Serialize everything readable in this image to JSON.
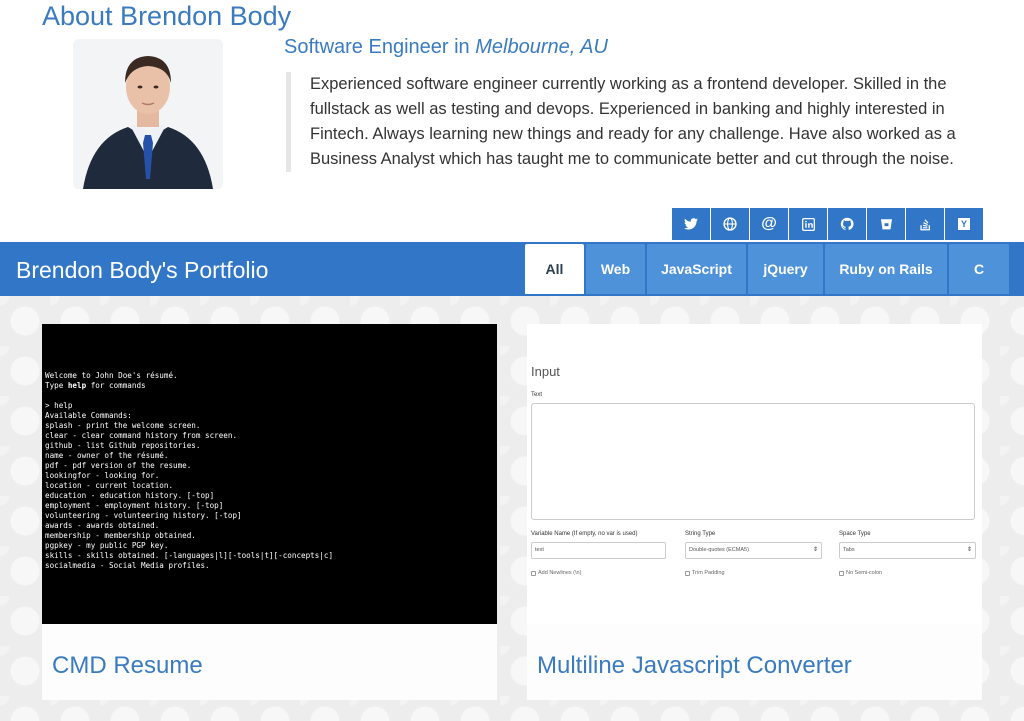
{
  "about": {
    "title": "About Brendon Body",
    "subtitle_prefix": "Software Engineer in ",
    "location": "Melbourne, AU",
    "bio": "Experienced software engineer currently working as a frontend developer. Skilled in the fullstack as well as testing and devops. Experienced in banking and highly interested in Fintech. Always learning new things and ready for any challenge. Have also worked as a Business Analyst which has taught me to communicate better and cut through the noise."
  },
  "social": [
    {
      "icon": "twitter-icon"
    },
    {
      "icon": "globe-icon"
    },
    {
      "icon": "at-icon",
      "glyph": "@"
    },
    {
      "icon": "linkedin-icon"
    },
    {
      "icon": "github-icon"
    },
    {
      "icon": "bitbucket-icon"
    },
    {
      "icon": "stackoverflow-icon"
    },
    {
      "icon": "hackernews-icon",
      "glyph": "Y"
    }
  ],
  "portfolio": {
    "title": "Brendon Body's Portfolio",
    "tabs": [
      {
        "label": "All",
        "active": true
      },
      {
        "label": "Web"
      },
      {
        "label": "JavaScript"
      },
      {
        "label": "jQuery"
      },
      {
        "label": "Ruby on Rails"
      },
      {
        "label": "C"
      }
    ],
    "cards": [
      {
        "title": "CMD Resume",
        "terminal": {
          "welcome_line": "Welcome to John Doe's résumé.",
          "type_prefix": "Type ",
          "type_keyword": "help",
          "type_suffix": " for commands",
          "prompt": "> help",
          "lines": [
            "Available Commands:",
            "splash - print the welcome screen.",
            "clear - clear command history from screen.",
            "github - list Github repositories.",
            "name - owner of the résumé.",
            "pdf - pdf version of the resume.",
            "lookingfor - looking for.",
            "location - current location.",
            "education - education history. [-top]",
            "employment - employment history. [-top]",
            "volunteering - volunteering history. [-top]",
            "awards - awards obtained.",
            "membership - membership obtained.",
            "pgpkey - my public PGP key.",
            "skills - skills obtained. [-languages|l][-tools|t][-concepts|c]",
            "socialmedia - Social Media profiles."
          ]
        }
      },
      {
        "title": "Multiline Javascript Converter",
        "converter": {
          "heading": "Input",
          "text_label": "Text",
          "var_label": "Variable Name (If empty, no var is used)",
          "var_value": "text",
          "string_label": "String Type",
          "string_value": "Double-quotes (ECMA5)",
          "space_label": "Space Type",
          "space_value": "Tabs",
          "check_newlines": "Add Newlines (\\n)",
          "check_trim": "Trim Padding",
          "check_semicolon": "No Semi-colon"
        }
      }
    ]
  },
  "colors": {
    "accent": "#3277c7",
    "tab": "#4e92d9",
    "title_text": "#3a7bbf"
  }
}
